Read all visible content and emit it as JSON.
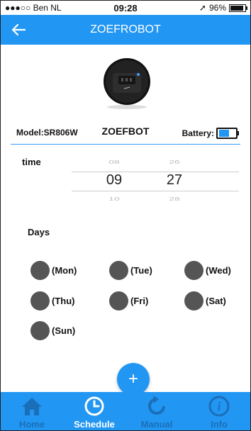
{
  "status": {
    "carrier": "●●●○○ Ben NL",
    "time": "09:28",
    "battery": "96%"
  },
  "header": {
    "title": "ZOEFROBOT"
  },
  "device": {
    "model": "Model:SR806W",
    "name": "ZOEFBOT",
    "battery_label": "Battery:"
  },
  "schedule": {
    "time_label": "time",
    "hour": {
      "prev": "08",
      "current": "09",
      "next": "10"
    },
    "minute": {
      "prev": "26",
      "current": "27",
      "next": "28"
    },
    "days_label": "Days",
    "days": [
      "(Mon)",
      "(Tue)",
      "(Wed)",
      "(Thu)",
      "(Fri)",
      "(Sat)",
      "(Sun)"
    ],
    "add_label": "+"
  },
  "tabs": [
    {
      "label": "Home",
      "icon": "home-icon"
    },
    {
      "label": "Schedule",
      "icon": "clock-icon"
    },
    {
      "label": "Manual",
      "icon": "refresh-icon"
    },
    {
      "label": "Info",
      "icon": "info-icon"
    }
  ],
  "colors": {
    "primary": "#2196f3",
    "inactive_tab": "#1b6fb8",
    "day_dot": "#555555"
  }
}
